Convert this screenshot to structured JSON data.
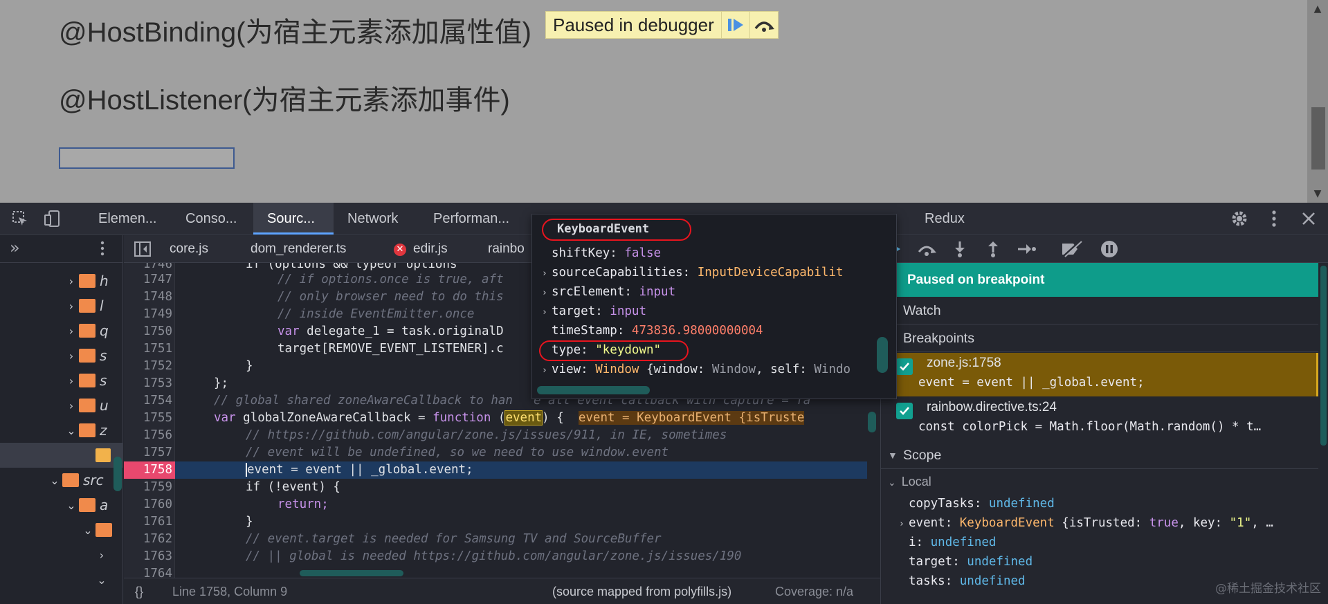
{
  "page": {
    "line1": "@HostBinding(为宿主元素添加属性值)",
    "line2": "@HostListener(为宿主元素添加事件)",
    "paused_banner": "Paused in debugger"
  },
  "devtools": {
    "tabs": [
      "Elemen...",
      "Conso...",
      "Sourc...",
      "Network",
      "Performan...",
      "Redux"
    ]
  },
  "editor": {
    "file_tabs": [
      "core.js",
      "dom_renderer.ts",
      "edir.js",
      "rainbo"
    ],
    "line_numbers": [
      "1746",
      "1747",
      "1748",
      "1749",
      "1750",
      "1751",
      "1752",
      "1753",
      "1754",
      "1755",
      "1756",
      "1757",
      "1758",
      "1759",
      "1760",
      "1761",
      "1762",
      "1763",
      "1764"
    ],
    "lines": {
      "l1746": "if (options && typeof options",
      "l1747": "// if options.once is true, aft",
      "l1748": "// only browser need to do this",
      "l1749": "// inside EventEmitter.once",
      "l1750_a": "var ",
      "l1750_b": "delegate_1 = task.originalD",
      "l1751": "target[REMOVE_EVENT_LISTENER].c",
      "l1752": "}",
      "l1753": "};",
      "l1754_a": "// global shared zoneAwareCallback to han",
      "l1754_b": "e all event callback with capture = fa",
      "l1755_a": "var ",
      "l1755_b": "globalZoneAwareCallback = ",
      "l1755_c": "function ",
      "l1755_d": "(",
      "l1755_e": "event",
      "l1755_f": ") {  ",
      "l1755_g": "event = KeyboardEvent {isTruste",
      "l1756": "// https://github.com/angular/zone.js/issues/911, in IE, sometimes",
      "l1757": "// event will be undefined, so we need to use window.event",
      "l1758_a": "event",
      "l1758_b": " = event || _global.event;",
      "l1759": "if (!event) {",
      "l1760": "return;",
      "l1761": "}",
      "l1762": "// event.target is needed for Samsung TV and SourceBuffer",
      "l1763": "// || global is needed https://github.com/angular/zone.js/issues/190",
      "l1764": ""
    },
    "status_left": "{}",
    "status_pos": "Line 1758, Column 9",
    "status_right": "(source mapped from polyfills.js)",
    "status_coverage": "Coverage: n/a"
  },
  "popover": {
    "title": "KeyboardEvent",
    "rows": [
      {
        "key": "shiftKey",
        "value": "false"
      },
      {
        "key": "sourceCapabilities",
        "value": "InputDeviceCapabilit"
      },
      {
        "key": "srcElement",
        "value": "input"
      },
      {
        "key": "target",
        "value": "input"
      },
      {
        "key": "timeStamp",
        "value": "473836.98000000004"
      },
      {
        "key": "type",
        "value": "\"keydown\""
      },
      {
        "key": "view",
        "value": "Window",
        "extra_a": "{window",
        "extra_b": "Window",
        "extra_c": "self",
        "extra_d": "Windo"
      }
    ]
  },
  "debugger": {
    "paused": "Paused on breakpoint",
    "watch": "Watch",
    "breakpoints": "Breakpoints",
    "bp_items": [
      {
        "file": "zone.js:1758",
        "code": "event = event || _global.event;"
      },
      {
        "file": "rainbow.directive.ts:24",
        "code": "const colorPick = Math.floor(Math.random() * t…"
      }
    ],
    "scope": "Scope",
    "local": "Local",
    "scope_vars": [
      {
        "key": "copyTasks",
        "value": "undefined"
      },
      {
        "key": "event",
        "value": "KeyboardEvent",
        "extra_a": "{isTrusted",
        "extra_b": "true",
        "extra_c": "key",
        "extra_d": "\"1\"",
        "extra_e": "…"
      },
      {
        "key": "i",
        "value": "undefined"
      },
      {
        "key": "target",
        "value": "undefined"
      },
      {
        "key": "tasks",
        "value": "undefined"
      }
    ],
    "watermark": "@稀土掘金技术社区"
  }
}
